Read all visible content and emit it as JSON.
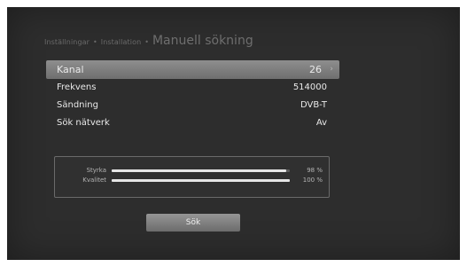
{
  "breadcrumb": {
    "items": [
      "Inställningar",
      "Installation"
    ],
    "separator": "•",
    "current": "Manuell sökning"
  },
  "menu": {
    "items": [
      {
        "label": "Kanal",
        "value": "26",
        "selected": true
      },
      {
        "label": "Frekvens",
        "value": "514000",
        "selected": false
      },
      {
        "label": "Sändning",
        "value": "DVB-T",
        "selected": false
      },
      {
        "label": "Sök nätverk",
        "value": "Av",
        "selected": false
      }
    ],
    "arrow_icon": "›"
  },
  "signal": {
    "strength": {
      "label": "Styrka",
      "value_text": "98 %",
      "level": 0.98
    },
    "quality": {
      "label": "Kvalitet",
      "value_text": "100 %",
      "level": 1.0
    }
  },
  "button": {
    "label": "Sök"
  },
  "colors": {
    "background": "#2d2d2d",
    "selected_row": "#7f7f7f",
    "bar_fill": "#e6e6e6"
  }
}
